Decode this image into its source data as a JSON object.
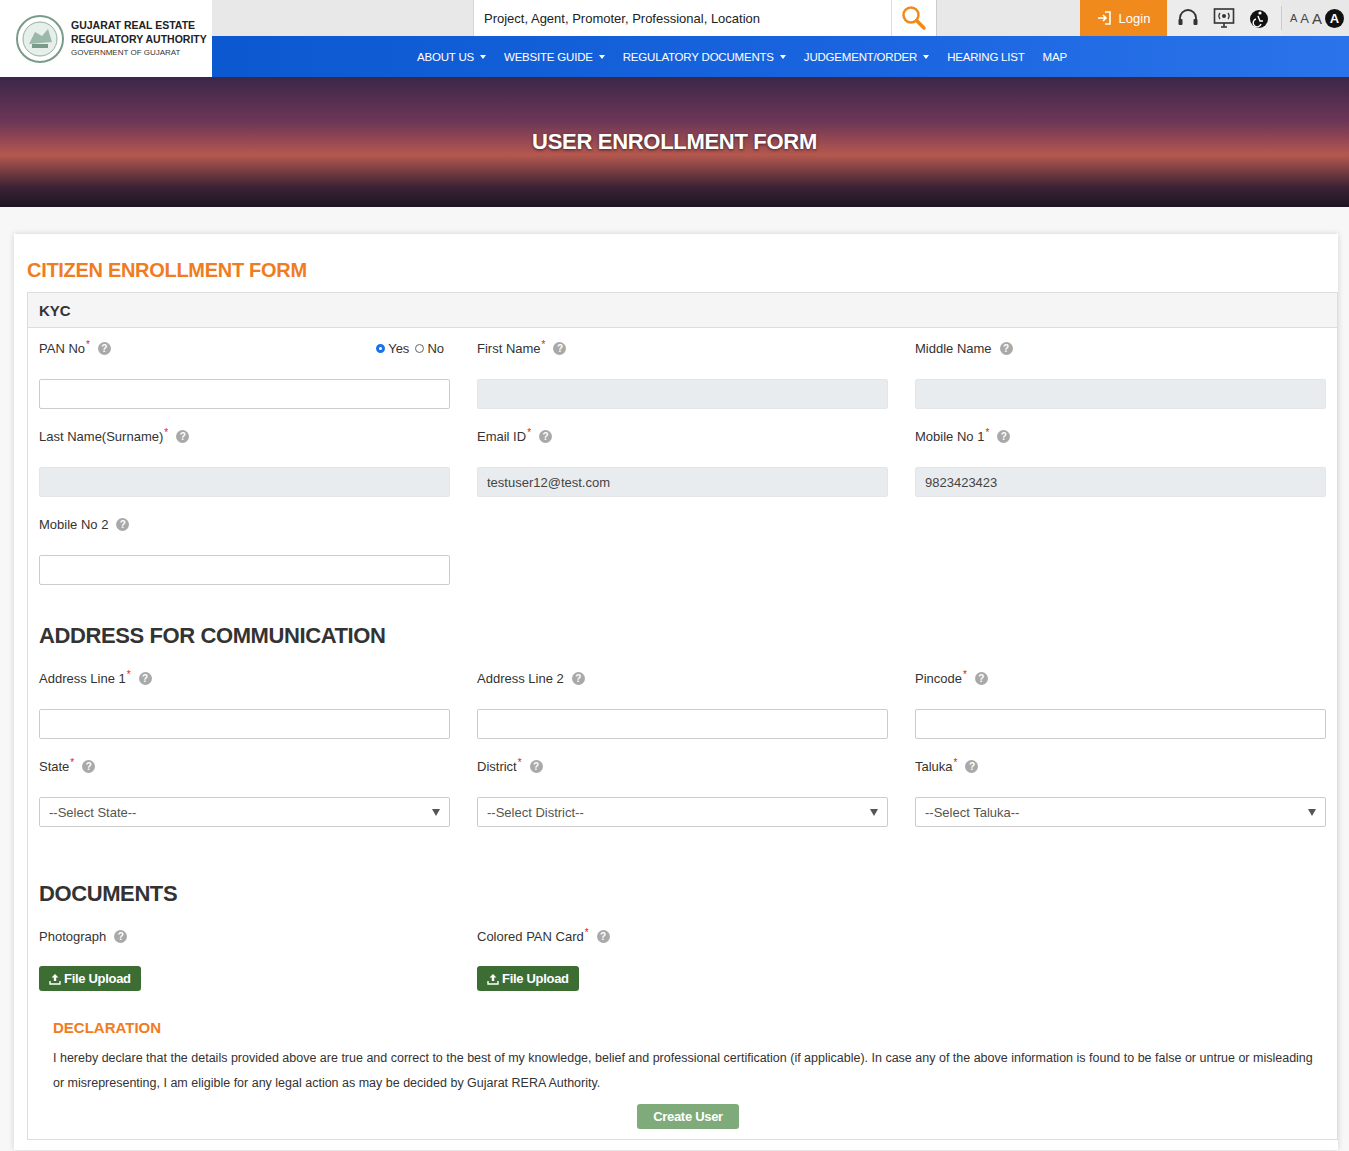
{
  "header": {
    "logo_lines": [
      "GUJARAT REAL ESTATE",
      "REGULATORY AUTHORITY",
      "GOVERNMENT OF GUJARAT"
    ],
    "search": {
      "placeholder": "Project, Agent, Promoter, Professional, Location"
    },
    "login": "Login",
    "font_sizes": [
      "A",
      "A",
      "A",
      "A"
    ]
  },
  "nav": [
    {
      "label": "ABOUT US",
      "dropdown": true
    },
    {
      "label": "WEBSITE GUIDE",
      "dropdown": true
    },
    {
      "label": "REGULATORY DOCUMENTS",
      "dropdown": true
    },
    {
      "label": "JUDGEMENT/ORDER",
      "dropdown": true
    },
    {
      "label": "HEARING LIST",
      "dropdown": false
    },
    {
      "label": "MAP",
      "dropdown": false
    }
  ],
  "banner": {
    "title": "USER ENROLLMENT FORM"
  },
  "form": {
    "title": "CITIZEN ENROLLMENT FORM",
    "required_mark": "*",
    "help_mark": "?",
    "kyc": {
      "title": "KYC",
      "fields": [
        {
          "label": "PAN No",
          "required": true,
          "kind": "text",
          "value": "",
          "disabled": false,
          "radios": [
            {
              "label": "Yes",
              "selected": true
            },
            {
              "label": "No",
              "selected": false
            }
          ]
        },
        {
          "label": "First Name",
          "required": true,
          "kind": "text",
          "value": "",
          "disabled": true,
          "radios": []
        },
        {
          "label": "Middle Name",
          "required": false,
          "kind": "text",
          "value": "",
          "disabled": true,
          "radios": []
        },
        {
          "label": "Last Name(Surname)",
          "required": true,
          "kind": "text",
          "value": "",
          "disabled": true,
          "radios": []
        },
        {
          "label": "Email ID",
          "required": true,
          "kind": "text",
          "value": "testuser12@test.com",
          "disabled": true,
          "radios": []
        },
        {
          "label": "Mobile No 1",
          "required": true,
          "kind": "text",
          "value": "9823423423",
          "disabled": true,
          "radios": []
        },
        {
          "label": "Mobile No 2",
          "required": false,
          "kind": "text",
          "value": "",
          "disabled": false,
          "radios": []
        }
      ]
    },
    "address": {
      "title": "ADDRESS FOR COMMUNICATION",
      "fields": [
        {
          "label": "Address Line 1",
          "required": true,
          "kind": "text",
          "value": "",
          "disabled": false,
          "radios": []
        },
        {
          "label": "Address Line 2",
          "required": false,
          "kind": "text",
          "value": "",
          "disabled": false,
          "radios": []
        },
        {
          "label": "Pincode",
          "required": true,
          "kind": "text",
          "value": "",
          "disabled": false,
          "radios": []
        },
        {
          "label": "State",
          "required": true,
          "kind": "select",
          "value": "--Select State--",
          "disabled": false,
          "radios": []
        },
        {
          "label": "District",
          "required": true,
          "kind": "select",
          "value": "--Select District--",
          "disabled": false,
          "radios": []
        },
        {
          "label": "Taluka",
          "required": true,
          "kind": "select",
          "value": "--Select Taluka--",
          "disabled": false,
          "radios": []
        }
      ]
    },
    "documents": {
      "title": "DOCUMENTS",
      "items": [
        {
          "label": "Photograph",
          "required": false,
          "button": "File Upload"
        },
        {
          "label": "Colored PAN Card",
          "required": true,
          "button": "File Upload"
        }
      ]
    },
    "declaration": {
      "title": "DECLARATION",
      "text": "I hereby declare that the details provided above are true and correct to the best of my knowledge, belief and professional certification (if applicable). In case any of the above information is found to be false or untrue or misleading or misrepresenting, I am eligible for any legal action as may be decided by Gujarat RERA Authority.",
      "button": {
        "label": "Create User",
        "disabled": true
      }
    }
  }
}
